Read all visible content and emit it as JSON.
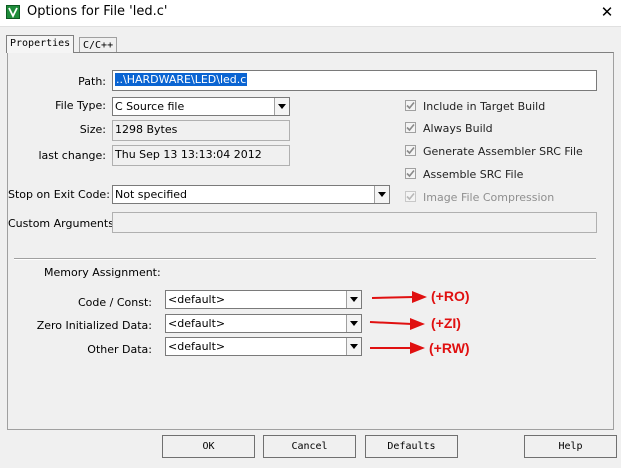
{
  "window": {
    "title": "Options for File 'led.c'",
    "close_glyph": "✕"
  },
  "tabs": [
    {
      "label": "Properties"
    },
    {
      "label": "C/C++"
    }
  ],
  "properties": {
    "path_label": "Path:",
    "path_value": "..\\HARDWARE\\LED\\led.c",
    "file_type_label": "File Type:",
    "file_type_value": "C Source file",
    "size_label": "Size:",
    "size_value": "1298 Bytes",
    "last_change_label": "last change:",
    "last_change_value": "Thu Sep 13 13:13:04 2012",
    "stop_label": "Stop on Exit Code:",
    "stop_value": "Not specified",
    "custom_label": "Custom Arguments:",
    "custom_value": ""
  },
  "checkboxes": [
    {
      "label": "Include in Target Build",
      "checked": true,
      "enabled": true
    },
    {
      "label": "Always Build",
      "checked": true,
      "enabled": true
    },
    {
      "label": "Generate Assembler SRC File",
      "checked": true,
      "enabled": true
    },
    {
      "label": "Assemble SRC File",
      "checked": true,
      "enabled": true
    },
    {
      "label": "Image File Compression",
      "checked": true,
      "enabled": false
    }
  ],
  "memory": {
    "heading": "Memory Assignment:",
    "code_label": "Code / Const:",
    "code_value": "<default>",
    "zero_label": "Zero Initialized Data:",
    "zero_value": "<default>",
    "other_label": "Other Data:",
    "other_value": "<default>"
  },
  "annotations": {
    "ro": "(+RO)",
    "zi": "(+ZI)",
    "rw": "(+RW)",
    "color": "#e01010"
  },
  "buttons": {
    "ok": "OK",
    "cancel": "Cancel",
    "defaults": "Defaults",
    "help": "Help"
  },
  "icons": {
    "app": "keil-uvision-icon",
    "close": "close-icon",
    "dropdown": "chevron-down-icon",
    "check": "check-icon"
  }
}
